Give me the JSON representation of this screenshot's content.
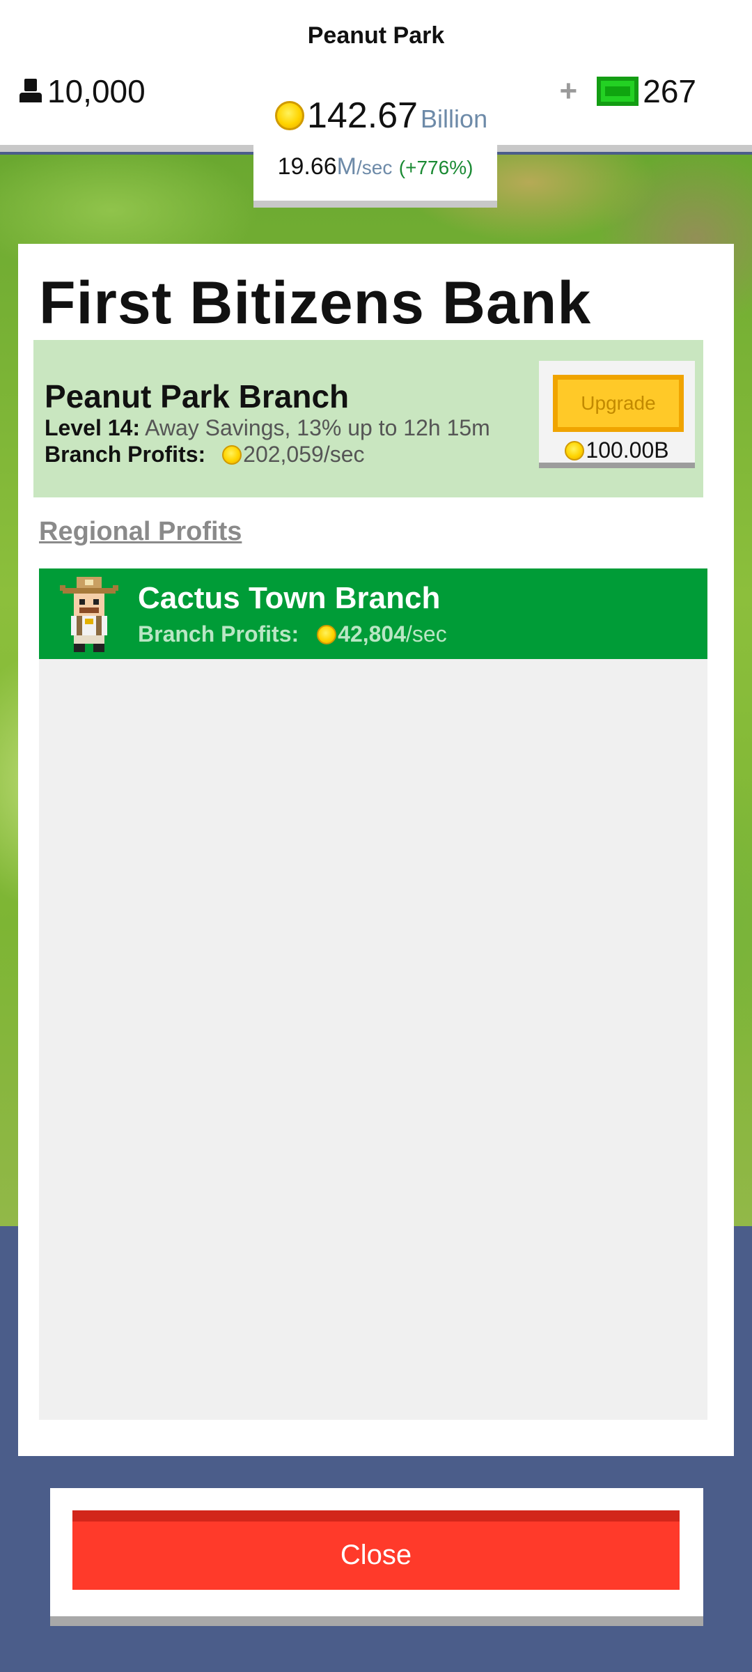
{
  "header": {
    "town_name": "Peanut Park",
    "population": "10,000",
    "gems_plus": "+",
    "gems": "267",
    "money_value": "142.67",
    "money_unit": "Billion",
    "rate_value": "19.66",
    "rate_unit_m": "M",
    "rate_unit": "/sec",
    "rate_change": "(+776%)"
  },
  "panel": {
    "title": "First Bitizens Bank",
    "branch": {
      "name": "Peanut Park Branch",
      "level_label": "Level 14:",
      "level_desc": "Away Savings, 13% up to 12h 15m",
      "profit_label": "Branch Profits:",
      "profit_value": "202,059/sec"
    },
    "upgrade": {
      "label": "Upgrade",
      "cost": "100.00B"
    },
    "regional_label": "Regional Profits",
    "regional": [
      {
        "name": "Cactus Town Branch",
        "profit_label": "Branch Profits:",
        "profit_value": "42,804",
        "profit_unit": "/sec"
      }
    ]
  },
  "close_label": "Close",
  "colors": {
    "accent_green": "#009c37",
    "branch_bg": "#c9e6c0",
    "upgrade_yellow": "#ffc928",
    "close_red": "#ff3a2a",
    "backdrop_blue": "#4b5d8a"
  },
  "icons": {
    "population": "person-icon",
    "gems": "green-gem-icon",
    "money": "gold-coin-icon"
  }
}
